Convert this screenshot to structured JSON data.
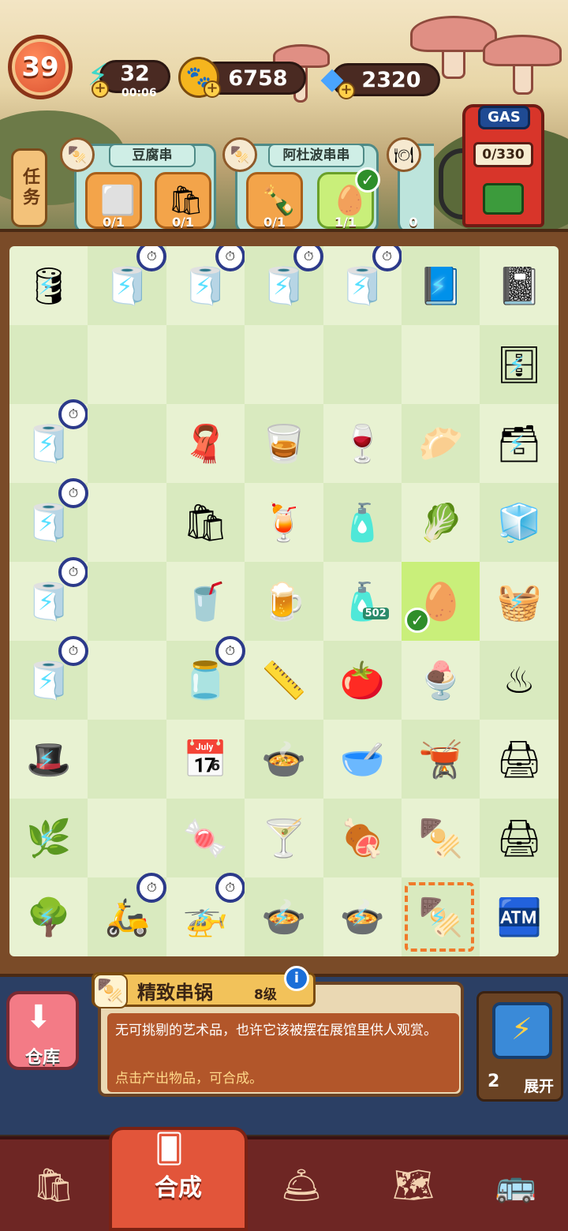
{
  "hud": {
    "level": "39",
    "energy": "32",
    "energy_timer": "00:06",
    "coins": "6758",
    "gems": "2320"
  },
  "gas_pump": {
    "title": "GAS",
    "value": "0/330"
  },
  "quests": {
    "button_label": "任务",
    "orders": [
      {
        "name": "豆腐串",
        "items": [
          {
            "icon": "tofu-icon",
            "count": "0/1"
          },
          {
            "icon": "takeout-box-icon",
            "count": "0/1"
          }
        ]
      },
      {
        "name": "阿杜波串串",
        "items": [
          {
            "icon": "sauce-bottle-icon",
            "count": "0/1"
          },
          {
            "icon": "egg-icon",
            "count": "1/1",
            "done": true
          }
        ]
      },
      {
        "name": "",
        "items": [
          {
            "icon": "plate-icon",
            "count": "0"
          }
        ]
      }
    ]
  },
  "board": {
    "rows": [
      [
        "barrel",
        "roll",
        "roll",
        "roll",
        "roll",
        "notebook",
        "spiral-pad"
      ],
      [
        "",
        "",
        "",
        "",
        "",
        "",
        "cabinet"
      ],
      [
        "roll",
        "",
        "cloth",
        "whisky-glass",
        "goblet",
        "meatball",
        "cabinet-small"
      ],
      [
        "roll",
        "",
        "paper-bag",
        "iced-drink",
        "glue-bottle",
        "cabbage",
        "sugar-cubes"
      ],
      [
        "roll",
        "",
        "cola-glass",
        "beer-glass",
        "glue-502",
        "egg",
        "rack"
      ],
      [
        "roll",
        "",
        "ink-bottle",
        "ruler",
        "ketchup",
        "parfait",
        "stove"
      ],
      [
        "wizard-hat",
        "",
        "calendar",
        "empty-pot",
        "soup-pot",
        "lidded-pot",
        "printer"
      ],
      [
        "bush",
        "",
        "candy",
        "cocktail",
        "meat-plate",
        "skewer-box",
        "printer-big"
      ],
      [
        "bush-big",
        "scooter",
        "drone",
        "hotpot",
        "hotpot-green",
        "hotpot-selected",
        "machine"
      ]
    ],
    "glyphs": {
      "barrel": "🛢",
      "roll": "🧻",
      "notebook": "📘",
      "spiral-pad": "📓",
      "cabinet": "🗄",
      "cloth": "🧣",
      "whisky-glass": "🥃",
      "goblet": "🍷",
      "meatball": "🥟",
      "cabinet-small": "🗃",
      "paper-bag": "🛍",
      "iced-drink": "🍹",
      "glue-bottle": "🧴",
      "cabbage": "🥬",
      "sugar-cubes": "🧊",
      "cola-glass": "🥤",
      "beer-glass": "🍺",
      "glue-502": "🧴",
      "egg": "🥚",
      "rack": "🧺",
      "ink-bottle": "🫙",
      "ruler": "📏",
      "ketchup": "🍅",
      "parfait": "🍨",
      "stove": "♨",
      "wizard-hat": "🎩",
      "calendar": "📅",
      "empty-pot": "🍲",
      "soup-pot": "🥣",
      "lidded-pot": "🫕",
      "printer": "🖨",
      "bush": "🌿",
      "candy": "🍬",
      "cocktail": "🍸",
      "meat-plate": "🍖",
      "skewer-box": "🍢",
      "printer-big": "🖨",
      "bush-big": "🌳",
      "scooter": "🛵",
      "drone": "🚁",
      "hotpot": "🍲",
      "hotpot-green": "🍲",
      "hotpot-selected": "🍢",
      "machine": "🏧"
    },
    "calendar_text": "6",
    "glue_label": "502"
  },
  "info": {
    "title": "精致串锅",
    "level": "8级",
    "desc": "无可挑剔的艺术品，也许它该被摆在展馆里供人观赏。",
    "hint": "点击产出物品，可合成。",
    "info_button": "i"
  },
  "warehouse": {
    "label": "仓库"
  },
  "expand": {
    "count": "2",
    "label": "展开"
  },
  "nav": {
    "items": [
      {
        "name": "nav-shop",
        "icon": "🛍"
      },
      {
        "name": "nav-merge",
        "label": "合成",
        "active": true
      },
      {
        "name": "nav-restaurant",
        "icon": "🛎"
      },
      {
        "name": "nav-map",
        "icon": "🗺"
      },
      {
        "name": "nav-bus",
        "icon": "🚌"
      }
    ]
  },
  "colors": {
    "board": "#e8f2d2",
    "accent": "#e2553a",
    "nav": "#6e2624"
  }
}
